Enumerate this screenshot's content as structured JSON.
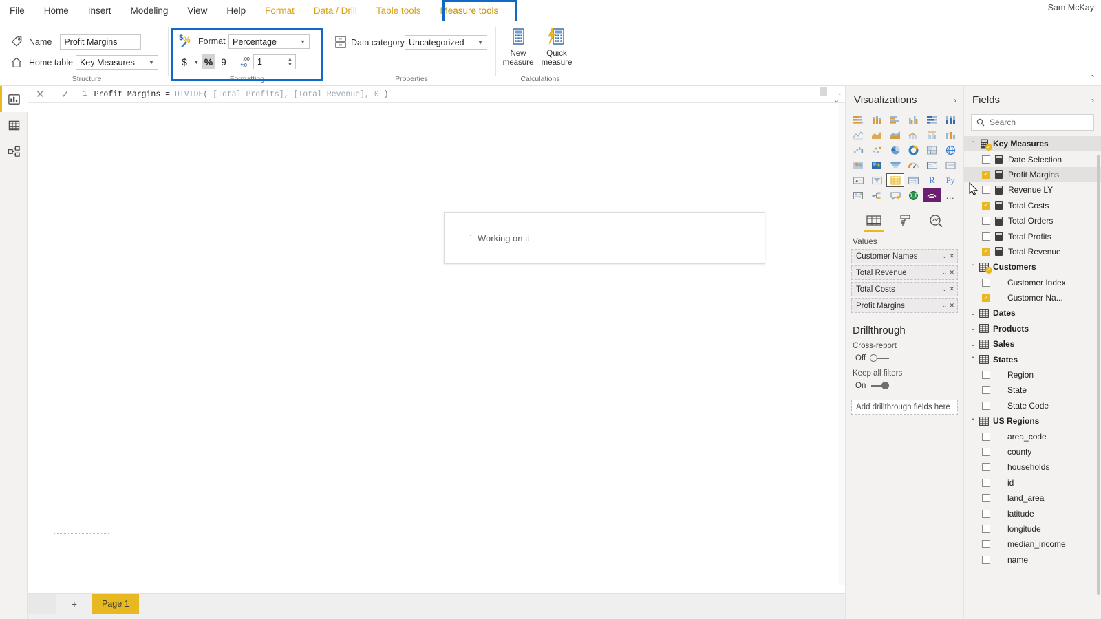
{
  "app": {
    "user": "Sam McKay"
  },
  "menubar": {
    "items": [
      {
        "label": "File",
        "type": "normal"
      },
      {
        "label": "Home",
        "type": "normal"
      },
      {
        "label": "Insert",
        "type": "normal"
      },
      {
        "label": "Modeling",
        "type": "normal"
      },
      {
        "label": "View",
        "type": "normal"
      },
      {
        "label": "Help",
        "type": "normal"
      },
      {
        "label": "Format",
        "type": "ctx"
      },
      {
        "label": "Data / Drill",
        "type": "ctx"
      },
      {
        "label": "Table tools",
        "type": "ctx"
      },
      {
        "label": "Measure tools",
        "type": "ctx-active"
      }
    ],
    "highlight_color": "#1069c4",
    "active_underline_color": "#e8b820"
  },
  "ribbon": {
    "groups": [
      {
        "name": "Structure",
        "label": "Structure"
      },
      {
        "name": "Formatting",
        "label": "Formatting"
      },
      {
        "name": "Properties",
        "label": "Properties"
      },
      {
        "name": "Calculations",
        "label": "Calculations"
      }
    ],
    "structure": {
      "name_label": "Name",
      "name_value": "Profit Margins",
      "home_table_label": "Home table",
      "home_table_value": "Key Measures"
    },
    "formatting": {
      "format_label": "Format",
      "format_value": "Percentage",
      "currency_symbol": "$",
      "percent_symbol": "%",
      "thousands_symbol": "9",
      "decimal_places_value": "1",
      "highlighted": true
    },
    "properties": {
      "data_category_label": "Data category",
      "data_category_value": "Uncategorized"
    },
    "calculations": {
      "new_measure_line1": "New",
      "new_measure_line2": "measure",
      "quick_measure_line1": "Quick",
      "quick_measure_line2": "measure"
    },
    "collapse_caret": "⌃"
  },
  "rail": {
    "items": [
      {
        "name": "report-view",
        "icon": "report-icon",
        "active": true
      },
      {
        "name": "data-view",
        "icon": "table-icon",
        "active": false
      },
      {
        "name": "model-view",
        "icon": "model-icon",
        "active": false
      }
    ]
  },
  "formula_bar": {
    "cancel": "✕",
    "commit": "✓",
    "line_number": "1",
    "measure_name": "Profit Margins",
    "equals": " = ",
    "function": "DIVIDE",
    "open_paren": "(",
    "arguments": " [Total Profits], [Total Revenue], 0 ",
    "close_paren": ")",
    "full_text": "Profit Margins = DIVIDE( [Total Profits], [Total Revenue], 0 )"
  },
  "canvas": {
    "dialog": {
      "text": "Working on it",
      "dot": "˙"
    }
  },
  "page_tabs": {
    "add_label": "+",
    "tabs": [
      {
        "label": "Page 1",
        "active": true
      }
    ]
  },
  "visualizations": {
    "title": "Visualizations",
    "chevron": "›",
    "collapse": "⌄",
    "icons": [
      "stacked-bar-chart-icon",
      "stacked-column-chart-icon",
      "clustered-bar-chart-icon",
      "clustered-column-chart-icon",
      "100-stacked-bar-chart-icon",
      "100-stacked-column-chart-icon",
      "line-chart-icon",
      "area-chart-icon",
      "stacked-area-chart-icon",
      "line-stacked-column-icon",
      "line-clustered-column-icon",
      "ribbon-chart-icon",
      "waterfall-chart-icon",
      "scatter-chart-icon",
      "pie-chart-icon",
      "donut-chart-icon",
      "treemap-icon",
      "map-icon",
      "filled-map-icon",
      "shape-map-icon",
      "funnel-icon",
      "gauge-icon",
      "multi-row-card-icon",
      "card-icon",
      "kpi-icon",
      "slicer-icon",
      "table-icon",
      "matrix-icon",
      "r-script-visual-icon",
      "py-script-visual-icon",
      "key-influencers-icon",
      "decomposition-tree-icon",
      "qa-visual-icon",
      "arcgis-map-icon",
      "paginated-report-icon",
      "more-options-icon"
    ],
    "selected_icon": "table-icon",
    "purple_icon": "paginated-report-icon",
    "tabs": [
      {
        "name": "fields-tab",
        "icon": "fields-grid-icon",
        "active": true
      },
      {
        "name": "format-tab",
        "icon": "paint-roller-icon",
        "active": false
      },
      {
        "name": "analytics-tab",
        "icon": "magnifier-chart-icon",
        "active": false
      }
    ],
    "well": {
      "title": "Values",
      "items": [
        {
          "label": "Customer Names"
        },
        {
          "label": "Total Revenue"
        },
        {
          "label": "Total Costs"
        },
        {
          "label": "Profit Margins"
        }
      ]
    },
    "drillthrough": {
      "title": "Drillthrough",
      "cross_report_label": "Cross-report",
      "cross_report_state": "Off",
      "keep_all_filters_label": "Keep all filters",
      "keep_all_filters_state": "On",
      "drop_zone": "Add drillthrough fields here"
    }
  },
  "fields": {
    "title": "Fields",
    "chevron": "›",
    "collapse": "⌃",
    "search_placeholder": "Search",
    "tables": [
      {
        "name": "Key Measures",
        "icon": "measures-table-icon",
        "expanded": true,
        "highlighted": true,
        "badge": true,
        "fields": [
          {
            "label": "Date Selection",
            "checked": false,
            "measure": true
          },
          {
            "label": "Profit Margins",
            "checked": true,
            "measure": true,
            "highlighted": true
          },
          {
            "label": "Revenue LY",
            "checked": false,
            "measure": true
          },
          {
            "label": "Total Costs",
            "checked": true,
            "measure": true
          },
          {
            "label": "Total Orders",
            "checked": false,
            "measure": true
          },
          {
            "label": "Total Profits",
            "checked": false,
            "measure": true
          },
          {
            "label": "Total Revenue",
            "checked": true,
            "measure": true
          }
        ]
      },
      {
        "name": "Customers",
        "icon": "table-icon",
        "expanded": true,
        "badge": true,
        "fields": [
          {
            "label": "Customer Index",
            "checked": false,
            "measure": false
          },
          {
            "label": "Customer Na...",
            "checked": true,
            "measure": false
          }
        ]
      },
      {
        "name": "Dates",
        "icon": "table-icon",
        "expanded": false,
        "fields": []
      },
      {
        "name": "Products",
        "icon": "table-icon",
        "expanded": false,
        "fields": []
      },
      {
        "name": "Sales",
        "icon": "table-icon",
        "expanded": false,
        "fields": []
      },
      {
        "name": "States",
        "icon": "table-icon",
        "expanded": true,
        "fields": [
          {
            "label": "Region",
            "checked": false,
            "measure": false
          },
          {
            "label": "State",
            "checked": false,
            "measure": false
          },
          {
            "label": "State Code",
            "checked": false,
            "measure": false
          }
        ]
      },
      {
        "name": "US Regions",
        "icon": "table-icon",
        "expanded": true,
        "fields": [
          {
            "label": "area_code",
            "checked": false,
            "measure": false
          },
          {
            "label": "county",
            "checked": false,
            "measure": false
          },
          {
            "label": "households",
            "checked": false,
            "measure": false
          },
          {
            "label": "id",
            "checked": false,
            "measure": false
          },
          {
            "label": "land_area",
            "checked": false,
            "measure": false
          },
          {
            "label": "latitude",
            "checked": false,
            "measure": false
          },
          {
            "label": "longitude",
            "checked": false,
            "measure": false
          },
          {
            "label": "median_income",
            "checked": false,
            "measure": false
          },
          {
            "label": "name",
            "checked": false,
            "measure": false
          }
        ]
      }
    ]
  },
  "colors": {
    "accent_yellow": "#e8b820",
    "highlight_blue": "#1069c4",
    "panel_bg": "#f3f2f1",
    "purple_visual": "#6b1f6e"
  }
}
